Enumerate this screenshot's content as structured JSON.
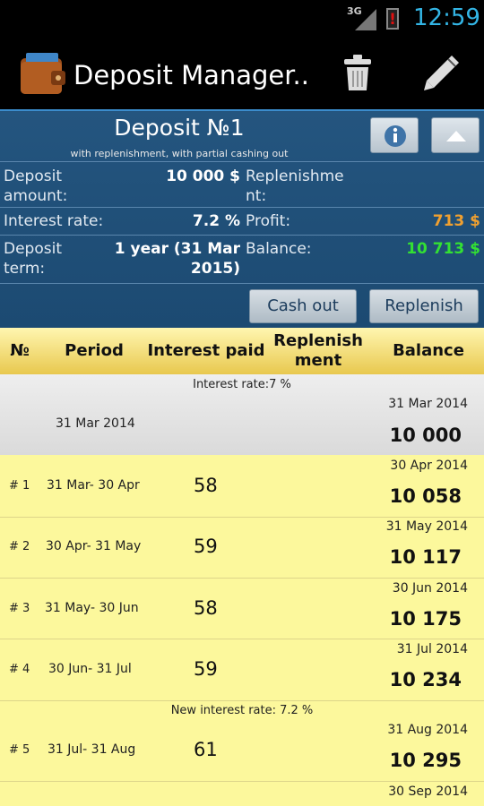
{
  "status_bar": {
    "network": "3G",
    "time": "12:59"
  },
  "action_bar": {
    "title": "Deposit Manager..."
  },
  "deposit": {
    "title": "Deposit №1",
    "subtitle": "with replenishment, with partial cashing out",
    "amount_label": "Deposit amount:",
    "amount_value": "10 000 $",
    "replenishment_label": "Replenishment:",
    "rate_label": "Interest rate:",
    "rate_value": "7.2 %",
    "profit_label": "Profit:",
    "profit_value": "713 $",
    "term_label": "Deposit term:",
    "term_value": "1 year (31 Mar 2015)",
    "balance_label": "Balance:",
    "balance_value": "10 713 $",
    "colors": {
      "profit": "#f0a030",
      "balance": "#33e033"
    }
  },
  "buttons": {
    "cash_out": "Cash out",
    "replenish": "Replenish"
  },
  "table": {
    "headers": [
      "№",
      "Period",
      "Interest paid",
      "Replenishment",
      "Balance"
    ],
    "initial": {
      "note": "Interest rate:7 %",
      "period": "31 Mar 2014",
      "date": "31 Mar 2014",
      "balance": "10 000"
    },
    "rows": [
      {
        "num": "# 1",
        "period": "31 Mar- 30 Apr",
        "interest": "58",
        "date": "30 Apr 2014",
        "balance": "10 058"
      },
      {
        "num": "# 2",
        "period": "30 Apr- 31 May",
        "interest": "59",
        "date": "31 May 2014",
        "balance": "10 117"
      },
      {
        "num": "# 3",
        "period": "31 May- 30 Jun",
        "interest": "58",
        "date": "30 Jun 2014",
        "balance": "10 175"
      },
      {
        "num": "# 4",
        "period": "30 Jun- 31 Jul",
        "interest": "59",
        "date": "31 Jul 2014",
        "balance": "10 234"
      },
      {
        "num": "# 5",
        "period": "31 Jul- 31 Aug",
        "interest": "61",
        "date": "31 Aug 2014",
        "balance": "10 295"
      }
    ],
    "rate_change_note": "New interest rate: 7.2 %",
    "next_date": "30 Sep 2014"
  }
}
